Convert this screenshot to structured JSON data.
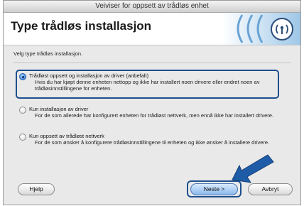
{
  "window": {
    "title": "Veiviser for oppsett av trådløs enhet"
  },
  "header": {
    "title": "Type trådløs installasjon"
  },
  "instruction": "Velg type trådløs installasjon.",
  "options": [
    {
      "title": "Trådløst oppsett og installasjon av driver (anbefalt)",
      "desc": "Hvis du har kjøpt denne enheten nettopp og ikke har installert noen drivere eller endret noen av trådløsinnstillingene for enheten.",
      "selected": true
    },
    {
      "title": "Kun installasjon av driver",
      "desc": "For de som allerede har konfigurert enheten for trådløst nettverk, men ennå ikke har installert drivere.",
      "selected": false
    },
    {
      "title": "Kun oppsett av trådløst nettverk",
      "desc": "For de som ønsker å konfigurere trådløsinnstillingene til enheten og ikke ønsker å installere drivere.",
      "selected": false
    }
  ],
  "buttons": {
    "help": "Hjelp",
    "next": "Neste >",
    "cancel": "Avbryt"
  },
  "colors": {
    "highlight": "#1e4f8f",
    "arrow": "#1f5ca8"
  },
  "icons": {
    "logo": "wireless-signal-icon",
    "arrow": "arrow-pointer-icon"
  }
}
